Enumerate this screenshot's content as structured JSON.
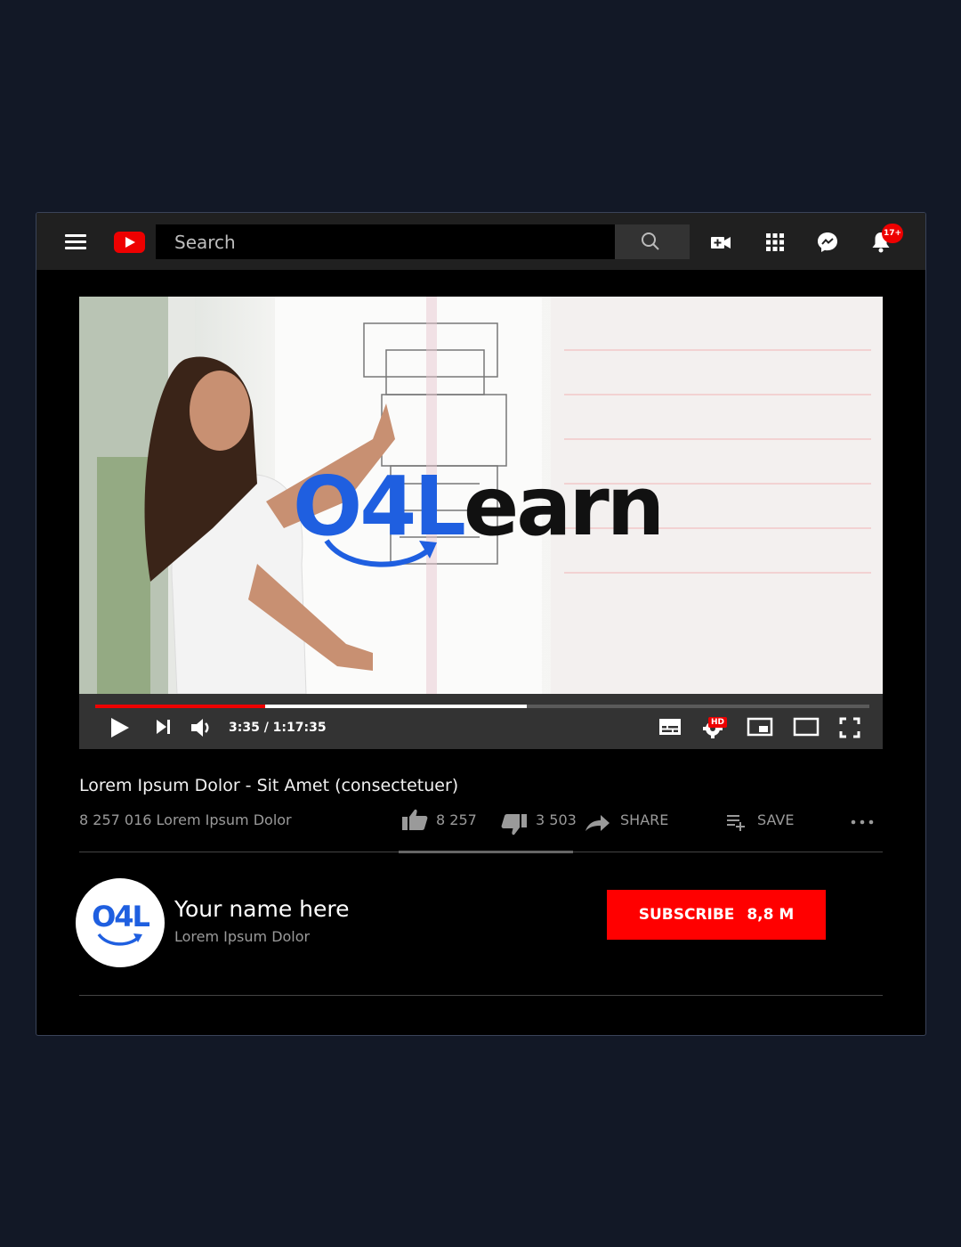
{
  "header": {
    "search_placeholder": "Search",
    "notification_count": "17+"
  },
  "video": {
    "overlay_logo": {
      "part1": "O4",
      "part2": "L",
      "part3": "earn"
    },
    "time_display": "3:35 / 1:17:35",
    "played_fraction": 0.22,
    "buffered_fraction": 0.558,
    "quality_badge": "HD"
  },
  "info": {
    "title": "Lorem Ipsum Dolor - Sit Amet (consectetuer)",
    "views": "8 257 016 Lorem Ipsum Dolor",
    "likes": "8 257",
    "dislikes": "3 503",
    "share_label": "SHARE",
    "save_label": "SAVE"
  },
  "channel": {
    "avatar_text": "O4L",
    "name": "Your name here",
    "subtitle": "Lorem Ipsum Dolor",
    "subscribe_label": "SUBSCRIBE",
    "subscriber_count": "8,8 M"
  },
  "colors": {
    "accent_red": "#ff0000",
    "logo_blue": "#1f5fe0",
    "page_bg": "#121826"
  }
}
